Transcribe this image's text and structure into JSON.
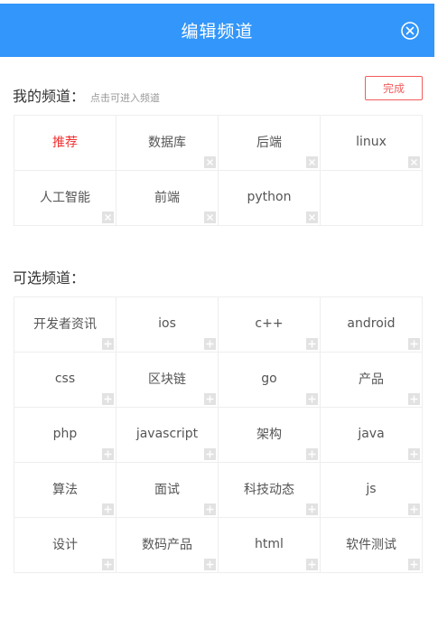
{
  "header": {
    "title": "编辑频道",
    "close_icon": "close-circle-icon"
  },
  "my_channels": {
    "title": "我的频道：",
    "hint": "点击可进入频道",
    "done_label": "完成",
    "items": [
      {
        "label": "推荐",
        "active": true
      },
      {
        "label": "数据库"
      },
      {
        "label": "后端"
      },
      {
        "label": "linux"
      },
      {
        "label": "人工智能"
      },
      {
        "label": "前端"
      },
      {
        "label": "python"
      }
    ]
  },
  "optional_channels": {
    "title": "可选频道：",
    "items": [
      {
        "label": "开发者资讯"
      },
      {
        "label": "ios"
      },
      {
        "label": "c++"
      },
      {
        "label": "android"
      },
      {
        "label": "css"
      },
      {
        "label": "区块链"
      },
      {
        "label": "go"
      },
      {
        "label": "产品"
      },
      {
        "label": "php"
      },
      {
        "label": "javascript"
      },
      {
        "label": "架构"
      },
      {
        "label": "java"
      },
      {
        "label": "算法"
      },
      {
        "label": "面试"
      },
      {
        "label": "科技动态"
      },
      {
        "label": "js"
      },
      {
        "label": "设计"
      },
      {
        "label": "数码产品"
      },
      {
        "label": "html"
      },
      {
        "label": "软件测试"
      }
    ]
  },
  "colors": {
    "header_bg": "#3296fa",
    "accent_red": "#f23030",
    "done_border": "#f25c5c"
  }
}
